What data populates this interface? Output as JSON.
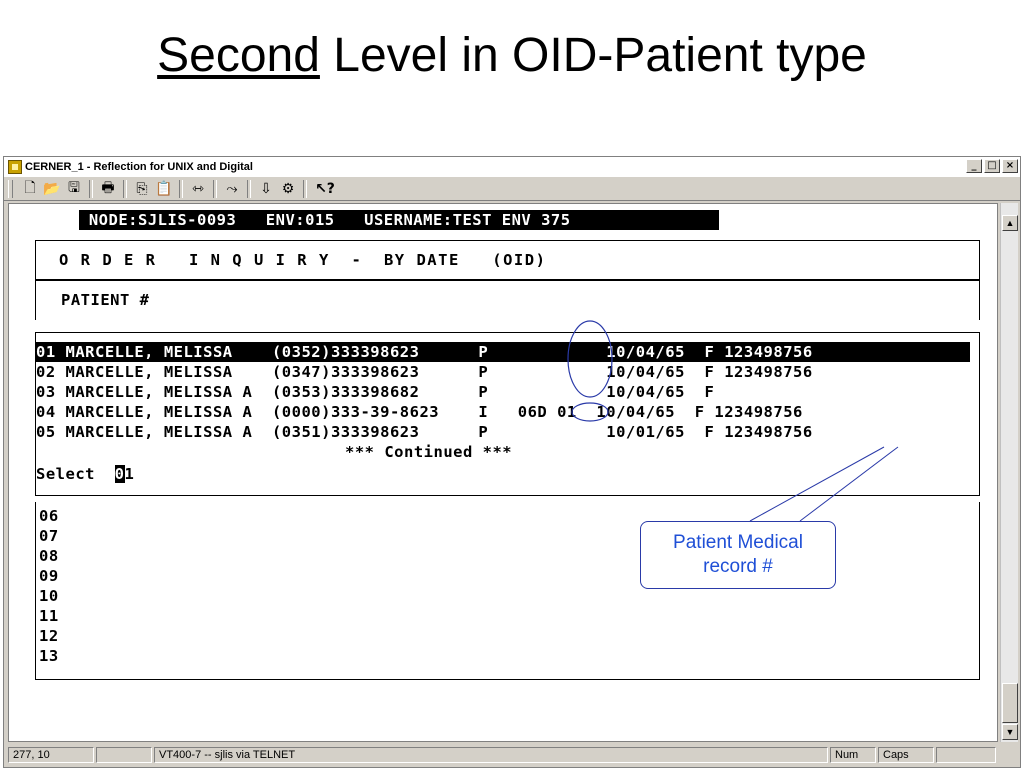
{
  "slide": {
    "title_underlined": "Second",
    "title_rest": " Level in OID-Patient type"
  },
  "window": {
    "title": "CERNER_1 - Reflection for UNIX and Digital",
    "minimize": "_",
    "maximize": "□",
    "close": "×"
  },
  "toolbar": {
    "buttons": [
      {
        "name": "new-icon",
        "glyph": "🗋"
      },
      {
        "name": "open-icon",
        "glyph": "📂"
      },
      {
        "name": "save-icon",
        "glyph": "🖫"
      },
      {
        "name": "print-icon",
        "glyph": "🖶"
      },
      {
        "name": "copy-icon",
        "glyph": "⎘"
      },
      {
        "name": "paste-icon",
        "glyph": "📋"
      },
      {
        "name": "connect-icon",
        "glyph": "⇿"
      },
      {
        "name": "disconnect-icon",
        "glyph": "⤳"
      },
      {
        "name": "transfer-icon",
        "glyph": "⇩"
      },
      {
        "name": "settings-icon",
        "glyph": "⚙"
      },
      {
        "name": "help-icon",
        "glyph": "↖?"
      }
    ]
  },
  "terminal": {
    "node_line": " NODE:SJLIS-0093   ENV:015   USERNAME:TEST ENV 375",
    "heading": "O R D E R   I N Q U I R Y  -  BY DATE   (OID)",
    "patient_label": "PATIENT #",
    "rows": [
      "01 MARCELLE, MELISSA    (0352)333398623      P            10/04/65  F 123498756",
      "02 MARCELLE, MELISSA    (0347)333398623      P            10/04/65  F 123498756",
      "03 MARCELLE, MELISSA A  (0353)333398682      P            10/04/65  F",
      "04 MARCELLE, MELISSA A  (0000)333-39-8623    I   06D 01  10/04/65  F 123498756",
      "05 MARCELLE, MELISSA A  (0351)333398623      P            10/01/65  F 123498756"
    ],
    "continued": "*** Continued ***",
    "select_label": "Select ",
    "select_cursor": "0",
    "select_value": "1",
    "empty_rows": [
      "06",
      "07",
      "08",
      "09",
      "10",
      "11",
      "12",
      "13"
    ]
  },
  "status": {
    "position": "277, 10",
    "blank1": "",
    "connection": "VT400-7 -- sjlis via TELNET",
    "num": "Num",
    "caps": "Caps"
  },
  "callout": {
    "line1": "Patient Medical",
    "line2": "record #"
  },
  "colors": {
    "annotation": "#1f4fd6",
    "window_bg": "#d4d0c8"
  }
}
